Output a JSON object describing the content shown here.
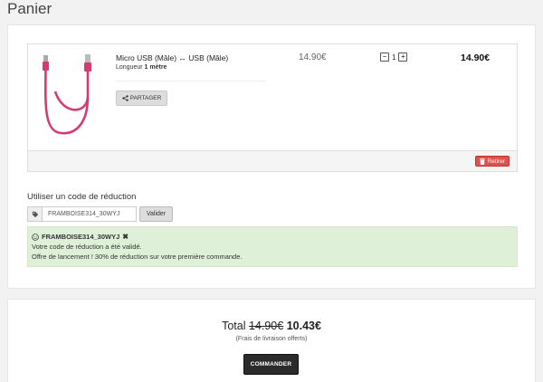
{
  "page": {
    "title": "Panier"
  },
  "cart": {
    "item": {
      "name": "Micro USB (Mâle) ↔ USB (Mâle)",
      "length_label": "Longueur",
      "length_value": "1 mètre",
      "share_label": "PARTAGER",
      "unit_price": "14.90€",
      "quantity": "1",
      "line_total": "14.90€",
      "remove_label": "Retirer",
      "cable_color": "#d63a75"
    },
    "coupon": {
      "heading": "Utiliser un code de réduction",
      "input_value": "FRAMBOISE314_30WYJ",
      "apply_label": "Valider",
      "alert_code": "FRAMBOISE314_30WYJ",
      "alert_line1": "Votre code de réduction a été validé.",
      "alert_line2": "Offre de lancement ! 30% de réduction sur votre première commande."
    }
  },
  "summary": {
    "total_label": "Total",
    "old_total": "14.90€",
    "new_total": "10.43€",
    "shipping_note": "(Frais de livraison offerts)",
    "order_label": "COMMANDER"
  }
}
